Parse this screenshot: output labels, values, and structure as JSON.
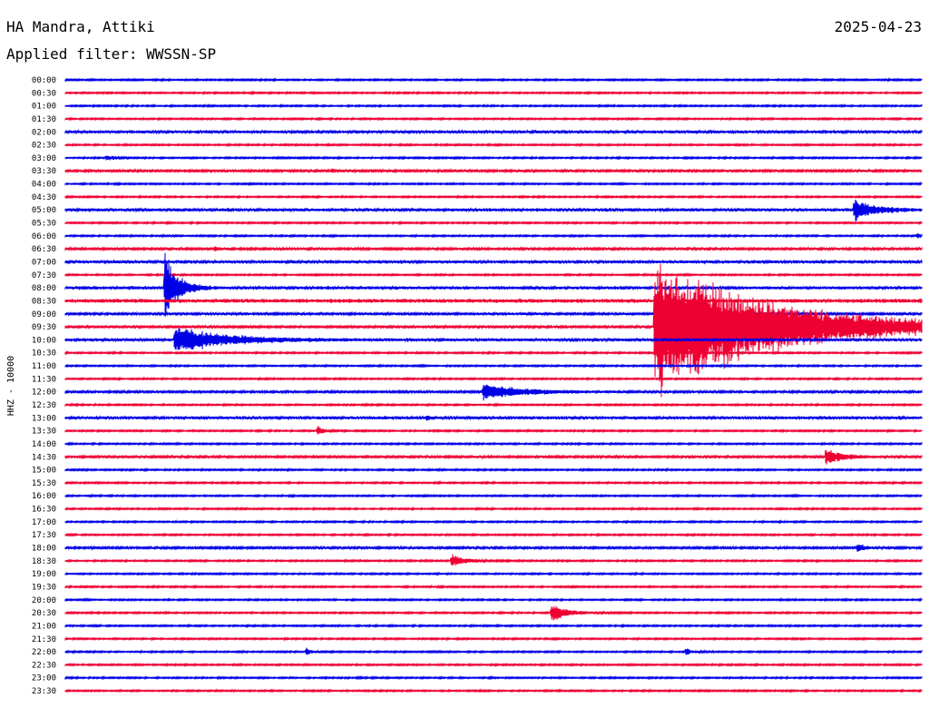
{
  "header": {
    "station": "HA Mandra, Attiki",
    "date": "2025-04-23",
    "filter": "Applied filter: WWSSN-SP"
  },
  "colors": {
    "odd_trace": "#0000e6",
    "even_trace": "#ee0033",
    "background": "#ffffff"
  },
  "chart_data": {
    "type": "line",
    "title": "HA Mandra, Attiki",
    "subtitle": "Applied filter: WWSSN-SP",
    "ylabel": "HHZ - 10000",
    "xlabel": "",
    "x_range_minutes": [
      0,
      30
    ],
    "grid": false,
    "rows": [
      "00:00",
      "00:30",
      "01:00",
      "01:30",
      "02:00",
      "02:30",
      "03:00",
      "03:30",
      "04:00",
      "04:30",
      "05:00",
      "05:30",
      "06:00",
      "06:30",
      "07:00",
      "07:30",
      "08:00",
      "08:30",
      "09:00",
      "09:30",
      "10:00",
      "10:30",
      "11:00",
      "11:30",
      "12:00",
      "12:30",
      "13:00",
      "13:30",
      "14:00",
      "14:30",
      "15:00",
      "15:30",
      "16:00",
      "16:30",
      "17:00",
      "17:30",
      "18:00",
      "18:30",
      "19:00",
      "19:30",
      "20:00",
      "20:30",
      "21:00",
      "21:30",
      "22:00",
      "22:30",
      "23:00",
      "23:30"
    ],
    "noise": [
      1,
      1,
      1,
      1,
      2,
      1,
      1,
      1.5,
      1,
      1,
      2,
      1,
      1,
      1.5,
      2,
      1,
      2,
      2.5,
      1.5,
      1.5,
      2,
      1,
      1,
      1,
      1.5,
      1,
      2,
      1,
      1,
      1.5,
      1,
      1,
      1,
      1,
      1,
      1,
      1.5,
      1,
      1,
      1,
      1,
      1,
      1,
      1,
      1,
      1,
      1,
      1
    ],
    "events": [
      {
        "row": 6,
        "t": 1.4,
        "amp": 3,
        "dur": 0.8
      },
      {
        "row": 7,
        "t": 9.3,
        "amp": 3,
        "dur": 0.5
      },
      {
        "row": 10,
        "t": 27.6,
        "amp": 14,
        "dur": 1.5
      },
      {
        "row": 12,
        "t": 29.8,
        "amp": 4,
        "dur": 0.3
      },
      {
        "row": 13,
        "t": 5.2,
        "amp": 3,
        "dur": 0.4
      },
      {
        "row": 16,
        "t": 3.45,
        "amp": 50,
        "dur": 0.9
      },
      {
        "row": 19,
        "t": 20.6,
        "amp": 85,
        "dur": 9
      },
      {
        "row": 20,
        "t": 3.8,
        "amp": 18,
        "dur": 3.5
      },
      {
        "row": 24,
        "t": 14.6,
        "amp": 10,
        "dur": 3
      },
      {
        "row": 26,
        "t": 12.6,
        "amp": 3,
        "dur": 0.4
      },
      {
        "row": 27,
        "t": 8.8,
        "amp": 7,
        "dur": 0.5
      },
      {
        "row": 29,
        "t": 26.6,
        "amp": 12,
        "dur": 1.2
      },
      {
        "row": 36,
        "t": 27.7,
        "amp": 6,
        "dur": 0.6
      },
      {
        "row": 37,
        "t": 13.5,
        "amp": 9,
        "dur": 1
      },
      {
        "row": 41,
        "t": 17.0,
        "amp": 12,
        "dur": 1.2
      },
      {
        "row": 44,
        "t": 8.4,
        "amp": 6,
        "dur": 0.4
      },
      {
        "row": 44,
        "t": 21.7,
        "amp": 5,
        "dur": 0.5
      }
    ]
  }
}
